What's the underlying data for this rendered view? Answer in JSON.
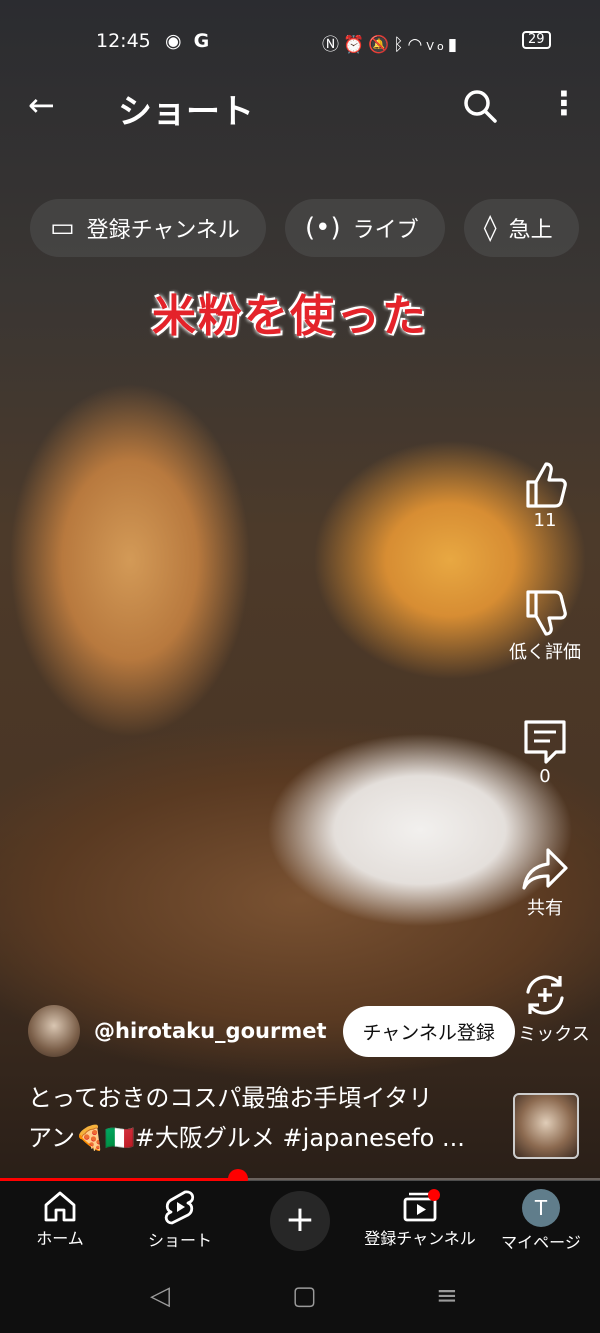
{
  "status_bar": {
    "time": "12:45",
    "left_icons": [
      "line-app-icon",
      "google-icon"
    ],
    "right_icons": [
      "nfc-icon",
      "alarm-icon",
      "mute-icon",
      "bluetooth-icon",
      "wifi-icon",
      "volte-icon",
      "signal-icon"
    ],
    "battery": "29"
  },
  "header": {
    "title": "ショート"
  },
  "chips": [
    {
      "icon": "subscriptions-icon",
      "label": "登録チャンネル"
    },
    {
      "icon": "live-icon",
      "label": "ライブ"
    },
    {
      "icon": "trending-icon",
      "label": "急上"
    }
  ],
  "video": {
    "overlay_caption": "米粉を使った"
  },
  "actions": {
    "like_count": "11",
    "dislike_label": "低く評価",
    "comment_count": "0",
    "share_label": "共有",
    "remix_label": "リミックス"
  },
  "channel": {
    "handle": "@hirotaku_gourmet",
    "subscribe_label": "チャンネル登録"
  },
  "description": {
    "line1": "とっておきのコスパ最強お手頃イタリ",
    "line2": "アン🍕🇮🇹#大阪グルメ #japanesefo ..."
  },
  "progress": {
    "fraction": 0.397
  },
  "bottom_nav": {
    "home": "ホーム",
    "shorts": "ショート",
    "subscriptions": "登録チャンネル",
    "mypage": "マイページ",
    "avatar_letter": "T"
  },
  "colors": {
    "accent": "#ff0000",
    "caption": "#e4232a",
    "nav_bg": "#0f0f0f"
  }
}
